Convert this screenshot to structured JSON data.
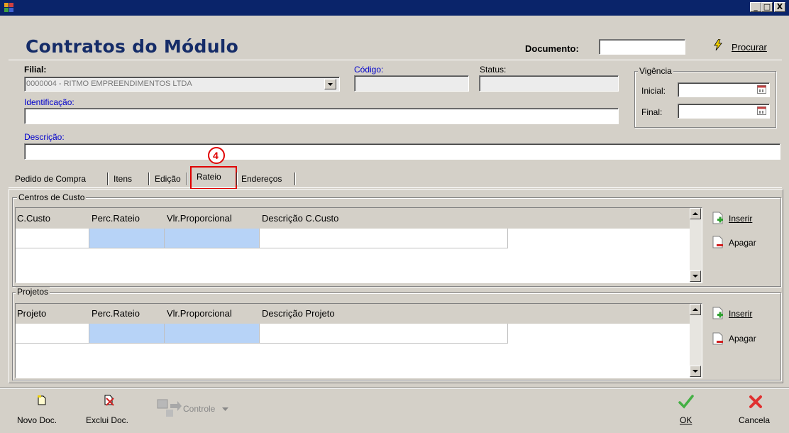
{
  "window": {
    "controls": [
      "_",
      "□",
      "X"
    ]
  },
  "header": {
    "title": "Contratos do Módulo",
    "documento_label": "Documento:",
    "documento_value": "",
    "procurar_label": "Procurar"
  },
  "form": {
    "filial_label": "Filial:",
    "filial_value": "0000004 - RITMO EMPREENDIMENTOS LTDA",
    "codigo_label": "Código:",
    "codigo_value": "",
    "status_label": "Status:",
    "status_value": "",
    "identificacao_label": "Identificação:",
    "identificacao_value": "",
    "descricao_label": "Descrição:",
    "descricao_value": "",
    "vigencia": {
      "legend": "Vigência",
      "inicial_label": "Inicial:",
      "final_label": "Final:",
      "inicial_value": "",
      "final_value": ""
    }
  },
  "annotation": {
    "number": "4",
    "color": "#e00000"
  },
  "tabs": [
    {
      "label": "Pedido de Compra"
    },
    {
      "label": "Itens"
    },
    {
      "label": "Edição"
    },
    {
      "label": "Rateio",
      "active": true
    },
    {
      "label": "Endereços"
    }
  ],
  "centros_de_custo": {
    "legend": "Centros de Custo",
    "columns": [
      "C.Custo",
      "Perc.Rateio",
      "Vlr.Proporcional",
      "Descrição C.Custo"
    ],
    "insert_label": "Inserir",
    "delete_label": "Apagar"
  },
  "projetos": {
    "legend": "Projetos",
    "columns": [
      "Projeto",
      "Perc.Rateio",
      "Vlr.Proporcional",
      "Descrição Projeto"
    ],
    "insert_label": "Inserir",
    "delete_label": "Apagar"
  },
  "toolbar": {
    "novo_label": "Novo Doc.",
    "exclui_label": "Exclui Doc.",
    "controle_label": "Controle",
    "ok_label": "OK",
    "cancela_label": "Cancela"
  },
  "colors": {
    "title_bar": "#0a246a",
    "title_text": "#152c68",
    "highlight_cell": "#b7d3f7",
    "label_blue": "#0000cc"
  }
}
